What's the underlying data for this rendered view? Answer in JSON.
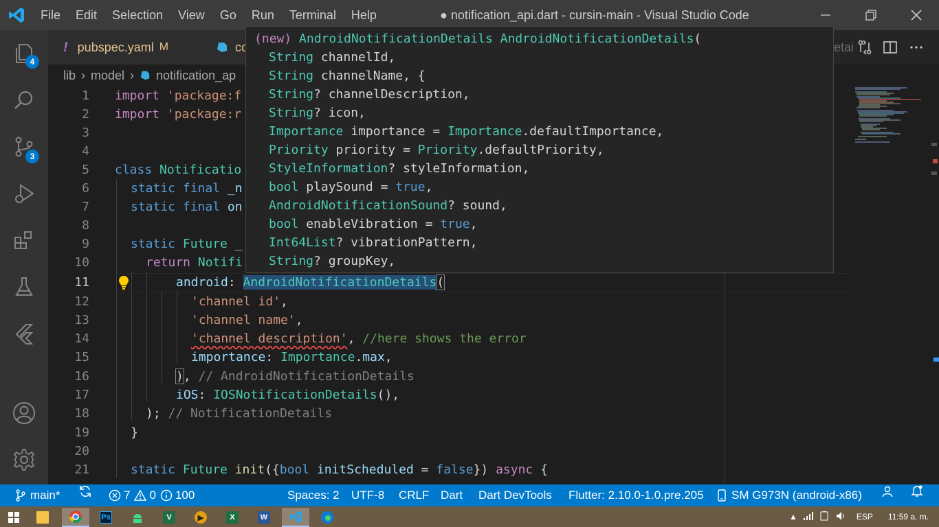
{
  "menu": [
    "File",
    "Edit",
    "Selection",
    "View",
    "Go",
    "Run",
    "Terminal",
    "Help"
  ],
  "window_title": "● notification_api.dart - cursin-main - Visual Studio Code",
  "activity": {
    "explorer_badge": "4",
    "scm_badge": "3"
  },
  "tabs": [
    {
      "label": "pubspec.yaml",
      "mark": "M",
      "icon": "!"
    },
    {
      "label": "co",
      "icon": "dart"
    }
  ],
  "tab_overflow_text": "etai",
  "breadcrumbs": [
    "lib",
    "model",
    "notification_ap"
  ],
  "gutter": [
    "1",
    "2",
    "3",
    "4",
    "5",
    "6",
    "7",
    "8",
    "9",
    "10",
    "11",
    "12",
    "13",
    "14",
    "15",
    "16",
    "17",
    "18",
    "19",
    "20",
    "21"
  ],
  "active_line": "11",
  "code": {
    "l1a": "import ",
    "l1b": "'package:f",
    "l2a": "import ",
    "l2b": "'package:r",
    "l5a": "class ",
    "l5b": "Notificatio",
    "l6a": "static final ",
    "l6b": "_n",
    "l7a": "static final ",
    "l7b": "on",
    "l9a": "static ",
    "l9b": "Future ",
    "l9c": "_",
    "l10a": "return ",
    "l10b": "Notifi",
    "l11a": "android",
    "l11b": ": ",
    "l11c": "AndroidNotificationDetails",
    "l11d": "(",
    "l12": "'channel id'",
    "l12b": ",",
    "l13": "'channel name'",
    "l13b": ",",
    "l14": "'channel description'",
    "l14b": ", ",
    "l14c": "//here shows the error",
    "l15a": "importance",
    "l15b": ": ",
    "l15c": "Importance",
    "l15d": ".",
    "l15e": "max",
    "l15f": ",",
    "l16a": ")",
    "l16b": ", ",
    "l16c": "// AndroidNotificationDetails",
    "l17a": "iOS",
    "l17b": ": ",
    "l17c": "IOSNotificationDetails",
    "l17d": "(),",
    "l18a": ");",
    "l18b": " // NotificationDetails",
    "l19": "}",
    "l21a": "static ",
    "l21b": "Future ",
    "l21c": "init",
    "l21d": "({",
    "l21e": "bool ",
    "l21f": "initScheduled",
    "l21g": " = ",
    "l21h": "false",
    "l21i": "}) ",
    "l21j": "async",
    "l21k": " {"
  },
  "hover": {
    "h1a": "(new) ",
    "h1b": "AndroidNotificationDetails",
    "h1c": " ",
    "h1d": "AndroidNotificationDetails",
    "h1e": "(",
    "h2a": "String",
    "h2b": " channelId,",
    "h3a": "String",
    "h3b": " channelName, {",
    "h4a": "String",
    "h4b": "? channelDescription,",
    "h5a": "String",
    "h5b": "? icon,",
    "h6a": "Importance",
    "h6b": " importance = ",
    "h6c": "Importance",
    "h6d": ".defaultImportance,",
    "h7a": "Priority",
    "h7b": " priority = ",
    "h7c": "Priority",
    "h7d": ".defaultPriority,",
    "h8a": "StyleInformation",
    "h8b": "? styleInformation,",
    "h9a": "bool",
    "h9b": " playSound = ",
    "h9c": "true",
    "h9d": ",",
    "h10a": "AndroidNotificationSound",
    "h10b": "? sound,",
    "h11a": "bool",
    "h11b": " enableVibration = ",
    "h11c": "true",
    "h11d": ",",
    "h12a": "Int64List",
    "h12b": "? vibrationPattern,",
    "h13a": "String",
    "h13b": "? groupKey,"
  },
  "status": {
    "branch": "main*",
    "errors": "7",
    "warnings": "0",
    "infos": "100",
    "spaces": "Spaces: 2",
    "encoding": "UTF-8",
    "eol": "CRLF",
    "language": "Dart",
    "devtools": "Dart DevTools",
    "flutter": "Flutter: 2.10.0-1.0.pre.205",
    "device": "SM G973N (android-x86)"
  },
  "taskbar": {
    "apps": [
      "windows-start",
      "file-explorer",
      "chrome",
      "photoshop",
      "android-studio",
      "vs-app",
      "plex",
      "excel",
      "word",
      "vscode",
      "edge"
    ],
    "ps_label": "Ps",
    "x_label": "X",
    "w_label": "W",
    "lang": "ESP",
    "time": "11:59 a. m."
  }
}
